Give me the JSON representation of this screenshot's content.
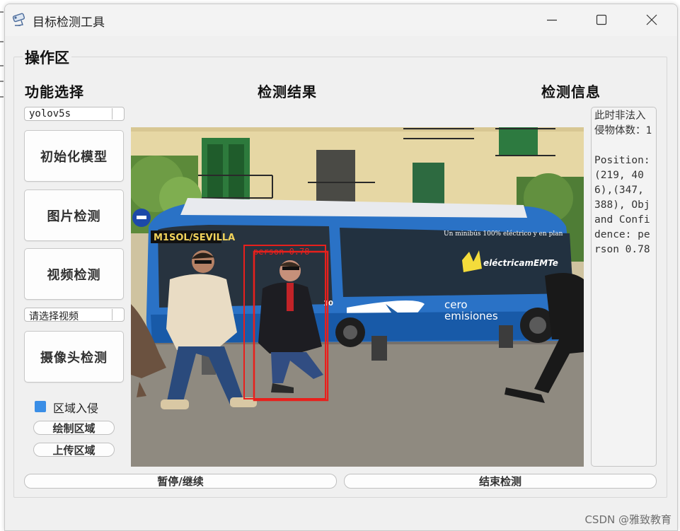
{
  "window": {
    "title": "目标检测工具"
  },
  "groupbox": {
    "title": "操作区"
  },
  "sections": {
    "function": "功能选择",
    "result": "检测结果",
    "info": "检测信息"
  },
  "controls": {
    "model_select": {
      "value": "yolov5s"
    },
    "init_model_label": "初始化模型",
    "image_detect_label": "图片检测",
    "video_detect_label": "视频检测",
    "video_select": {
      "value": "请选择视频"
    },
    "camera_detect_label": "摄像头检测",
    "region_checkbox": {
      "label": "区域入侵",
      "checked": true
    },
    "draw_region_label": "绘制区域",
    "upload_region_label": "上传区域",
    "pause_label": "暂停/继续",
    "stop_label": "结束检测"
  },
  "detection": {
    "box_label": "person 0.78",
    "bus_sign": "M1SOL/SEVILLA",
    "bus_text1": "cero",
    "bus_text2": "emisiones",
    "bus_brand": "eléctricamEMTe",
    "bus_slogan": "Un minibús 100% eléctrico y en plan",
    "bus_number": "10"
  },
  "info": {
    "text": "此时非法入侵物体数：1\n\nPosition:(219, 406),(347, 388), Obj and Confidence: person 0.78"
  },
  "watermark": "CSDN @雅致教育",
  "colors": {
    "accent": "#3a8ee6",
    "bbox": "#e8201c",
    "bus": "#1f6fc4"
  }
}
